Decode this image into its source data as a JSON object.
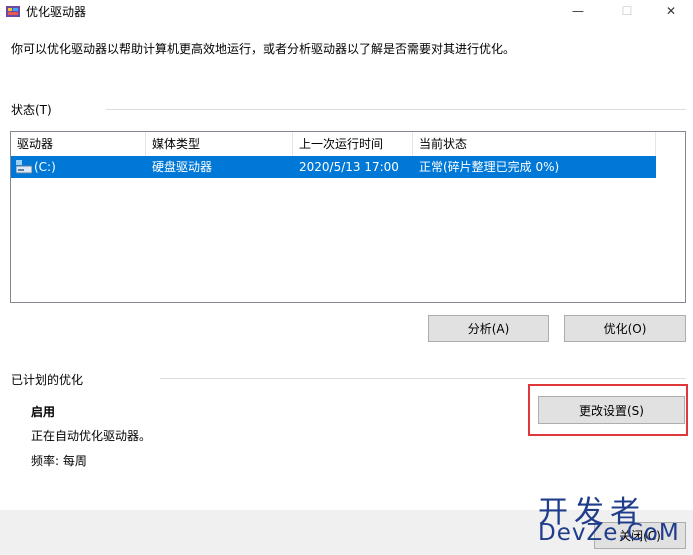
{
  "window": {
    "title": "优化驱动器",
    "minimize_glyph": "—",
    "maximize_glyph": "☐",
    "close_glyph": "✕"
  },
  "intro_text": "你可以优化驱动器以帮助计算机更高效地运行，或者分析驱动器以了解是否需要对其进行优化。",
  "status_section": {
    "label": "状态(T)",
    "columns": [
      "驱动器",
      "媒体类型",
      "上一次运行时间",
      "当前状态"
    ],
    "rows": [
      {
        "drive": "(C:)",
        "media_type": "硬盘驱动器",
        "last_run": "2020/5/13 17:00",
        "status": "正常(碎片整理已完成 0%)",
        "selected": true
      }
    ],
    "analyze_button": "分析(A)",
    "optimize_button": "优化(O)"
  },
  "scheduled_section": {
    "label": "已计划的优化",
    "state": "启用",
    "description": "正在自动优化驱动器。",
    "frequency": "频率: 每周",
    "change_settings_button": "更改设置(S)"
  },
  "footer": {
    "close_button_partial": "关闭(C)"
  },
  "watermark": {
    "line1": "开发者",
    "line2": "DevZe.CoM"
  },
  "colors": {
    "selection": "#0078d7",
    "highlight_box": "#e0383a",
    "button_face": "#e1e1e1"
  }
}
